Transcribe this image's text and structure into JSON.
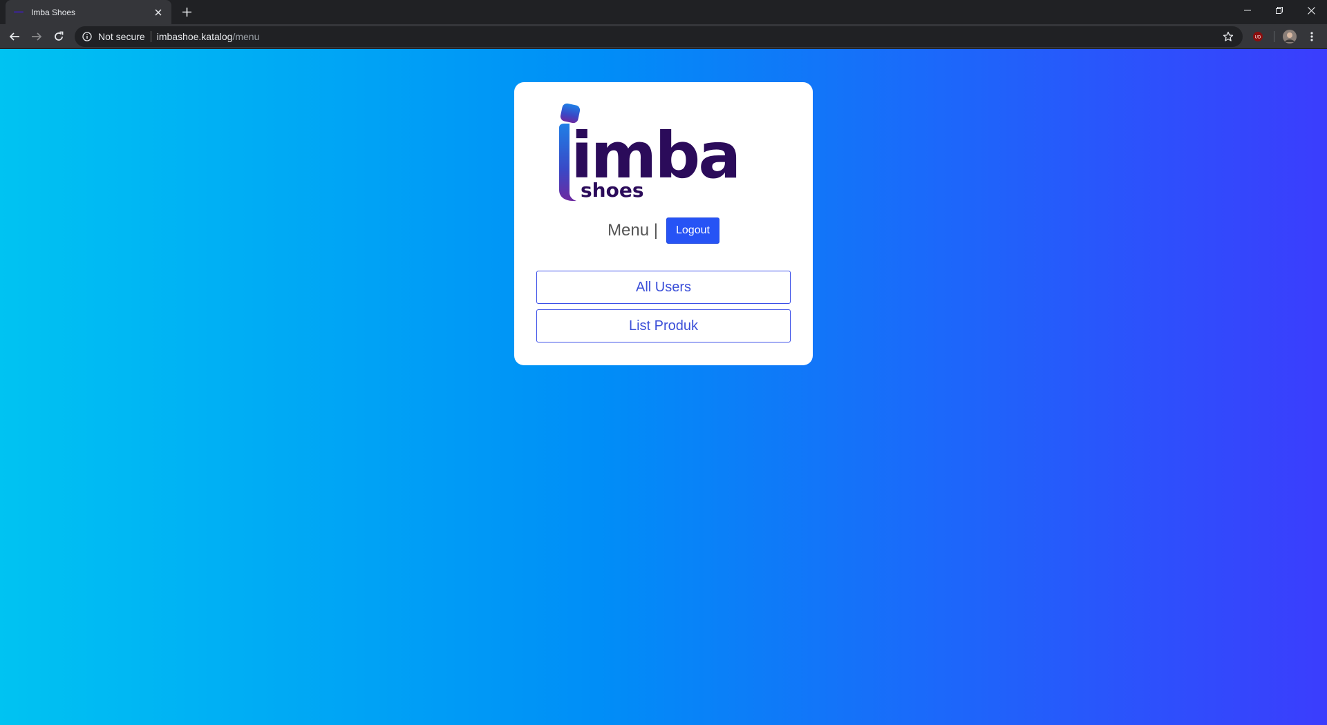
{
  "browser": {
    "tab": {
      "title": "Imba Shoes"
    },
    "omnibox": {
      "security_label": "Not secure",
      "host": "imbashoe.katalog",
      "path": "/menu"
    },
    "extension_badge": "UD"
  },
  "page": {
    "logo": {
      "main": "imba",
      "sub": "shoes"
    },
    "menu_label": "Menu |",
    "logout_label": "Logout",
    "buttons": [
      {
        "label": "All Users"
      },
      {
        "label": "List Produk"
      }
    ]
  },
  "colors": {
    "gradient_start": "#00c3f2",
    "gradient_end": "#3b3dfd",
    "logo_purple": "#2b0b5a",
    "logout_bg": "#2653f5",
    "outline_blue": "#3a4ee8"
  }
}
